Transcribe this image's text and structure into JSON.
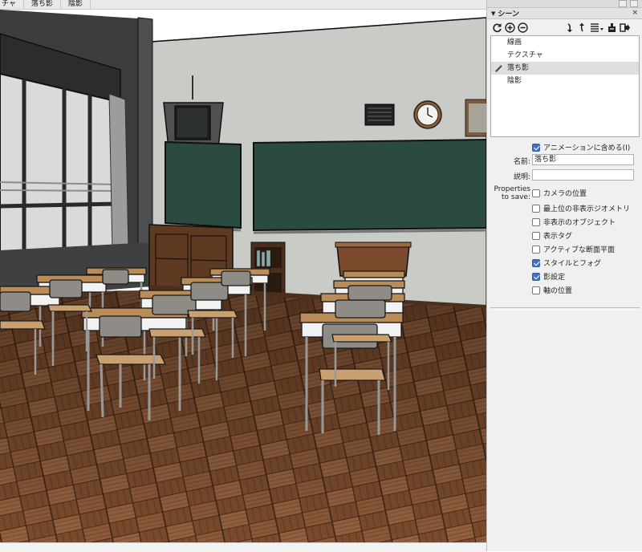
{
  "scene_tabs": [
    "チャ",
    "落ち影",
    "陰影"
  ],
  "tray": {
    "panel_title": "シーン",
    "close_label": "×",
    "scenes": [
      {
        "label": "線画",
        "active": false
      },
      {
        "label": "テクスチャ",
        "active": false
      },
      {
        "label": "落ち影",
        "active": true
      },
      {
        "label": "陰影",
        "active": false
      }
    ],
    "include_in_animation_label": "アニメーションに含める(I)",
    "include_in_animation_checked": true,
    "name_label": "名前:",
    "name_value": "落ち影",
    "description_label": "説明:",
    "description_value": "",
    "properties_label_line1": "Properties",
    "properties_label_line2": "to save:",
    "properties": [
      {
        "label": "カメラの位置",
        "checked": false
      },
      {
        "label": "最上位の非表示ジオメトリ",
        "checked": false
      },
      {
        "label": "非表示のオブジェクト",
        "checked": false
      },
      {
        "label": "表示タグ",
        "checked": false
      },
      {
        "label": "アクティブな断面平面",
        "checked": false
      },
      {
        "label": "スタイルとフォグ",
        "checked": true
      },
      {
        "label": "影設定",
        "checked": true
      },
      {
        "label": "軸の位置",
        "checked": false
      }
    ]
  },
  "toolbar_icons": [
    "refresh-icon",
    "add-scene-icon",
    "remove-scene-icon",
    "move-scene-down-icon",
    "move-scene-up-icon",
    "view-options-icon",
    "details-icon",
    "export-icon"
  ],
  "colors": {
    "wall": "#c7c9c5",
    "chalkboard": "#2a4b41",
    "floor_light": "#8a5a3a",
    "floor_dark": "#5c3620",
    "checkbox_on": "#3d76c7"
  }
}
